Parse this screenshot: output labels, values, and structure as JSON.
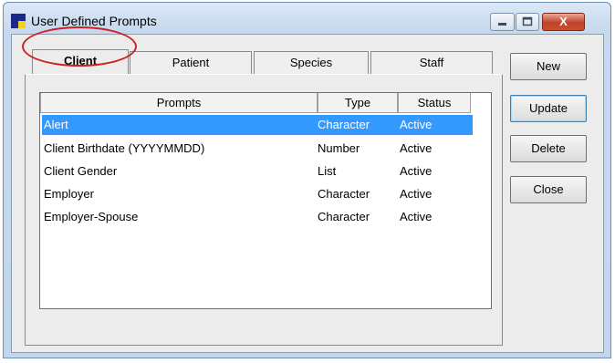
{
  "window": {
    "title": "User Defined Prompts",
    "close_glyph": "X"
  },
  "tabs": [
    {
      "label": "Client",
      "active": true
    },
    {
      "label": "Patient",
      "active": false
    },
    {
      "label": "Species",
      "active": false
    },
    {
      "label": "Staff",
      "active": false
    }
  ],
  "table": {
    "columns": [
      "Prompts",
      "Type",
      "Status"
    ],
    "rows": [
      {
        "prompt": "Alert",
        "type": "Character",
        "status": "Active",
        "selected": true
      },
      {
        "prompt": "Client Birthdate (YYYYMMDD)",
        "type": "Number",
        "status": "Active",
        "selected": false
      },
      {
        "prompt": "Client Gender",
        "type": "List",
        "status": "Active",
        "selected": false
      },
      {
        "prompt": "Employer",
        "type": "Character",
        "status": "Active",
        "selected": false
      },
      {
        "prompt": "Employer-Spouse",
        "type": "Character",
        "status": "Active",
        "selected": false
      }
    ]
  },
  "buttons": {
    "new": "New",
    "update": "Update",
    "delete": "Delete",
    "close": "Close"
  },
  "icons": {
    "app": "app-window-icon",
    "minimize": "minimize-icon",
    "maximize": "maximize-icon",
    "close": "close-icon"
  },
  "colors": {
    "selection": "#3399ff",
    "highlight_oval": "#cc2222",
    "close_button": "#c7522f"
  }
}
